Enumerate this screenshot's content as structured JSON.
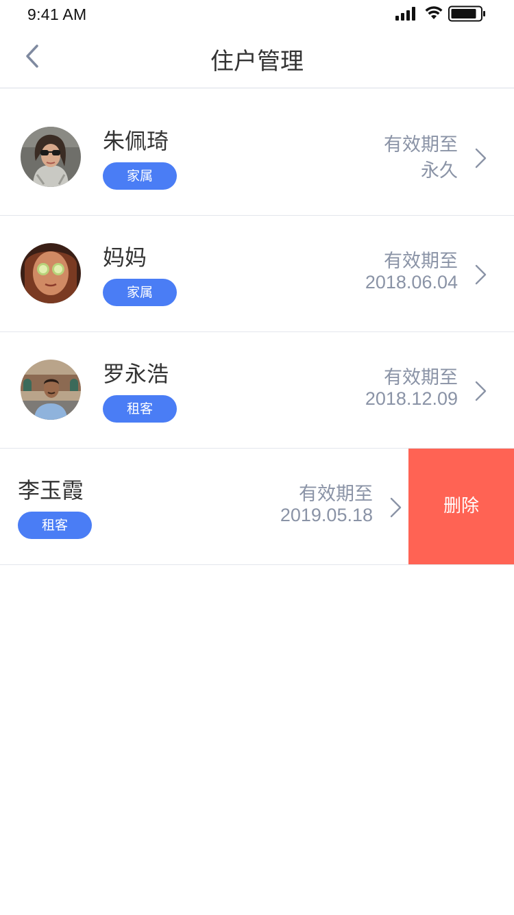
{
  "status_bar": {
    "time": "9:41 AM",
    "icons": [
      "signal-icon",
      "wifi-icon",
      "battery-icon"
    ]
  },
  "nav": {
    "title": "住户管理",
    "back_icon": "chevron-left-icon"
  },
  "validity_label": "有效期至",
  "residents": [
    {
      "name": "朱佩琦",
      "tag": "家属",
      "valid_until": "永久",
      "avatar": "woman-sunglasses-avatar"
    },
    {
      "name": "妈妈",
      "tag": "家属",
      "valid_until": "2018.06.04",
      "avatar": "woman-cucumber-mask-avatar"
    },
    {
      "name": "罗永浩",
      "tag": "租客",
      "valid_until": "2018.12.09",
      "avatar": "man-outdoor-avatar"
    },
    {
      "name": "李玉霞",
      "tag": "租客",
      "valid_until": "2019.05.18",
      "avatar": ""
    }
  ],
  "delete_label": "删除",
  "colors": {
    "accent": "#4a7df5",
    "danger": "#ff6354",
    "muted_text": "#8a93a6",
    "primary_text": "#333333",
    "divider": "#e3e6ec"
  }
}
